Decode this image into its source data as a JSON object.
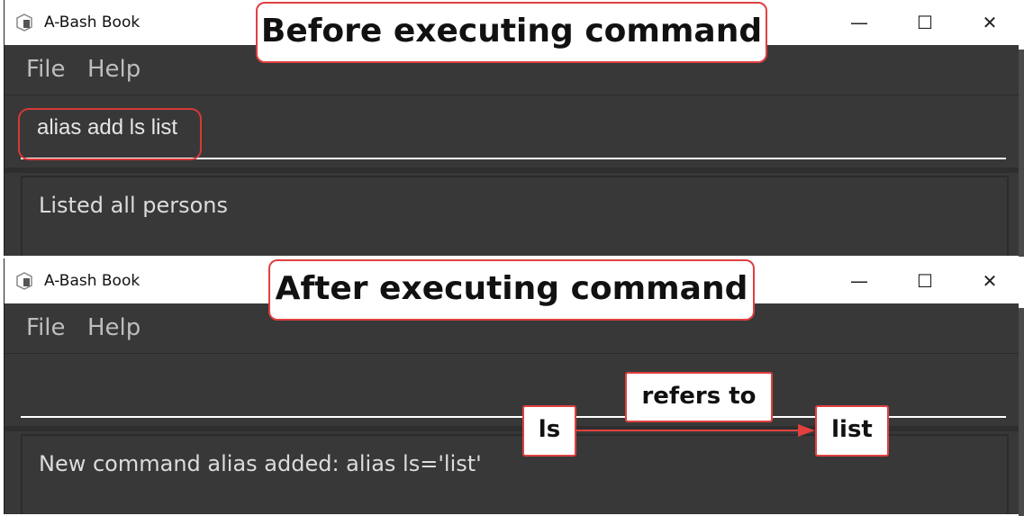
{
  "annotations": {
    "before_title": "Before executing command",
    "after_title": "After executing command",
    "alias_label": "ls",
    "relation_label": "refers to",
    "target_label": "list",
    "accent_color": "#e04040"
  },
  "windows": [
    {
      "title": "A-Bash Book",
      "controls": {
        "minimize": "—",
        "maximize": "☐",
        "close": "✕"
      },
      "menu": [
        "File",
        "Help"
      ],
      "command_input": "alias add ls list",
      "result": "Listed all persons"
    },
    {
      "title": "A-Bash Book",
      "controls": {
        "minimize": "—",
        "maximize": "☐",
        "close": "✕"
      },
      "menu": [
        "File",
        "Help"
      ],
      "command_input": "",
      "result": "New command alias added: alias ls='list'"
    }
  ]
}
